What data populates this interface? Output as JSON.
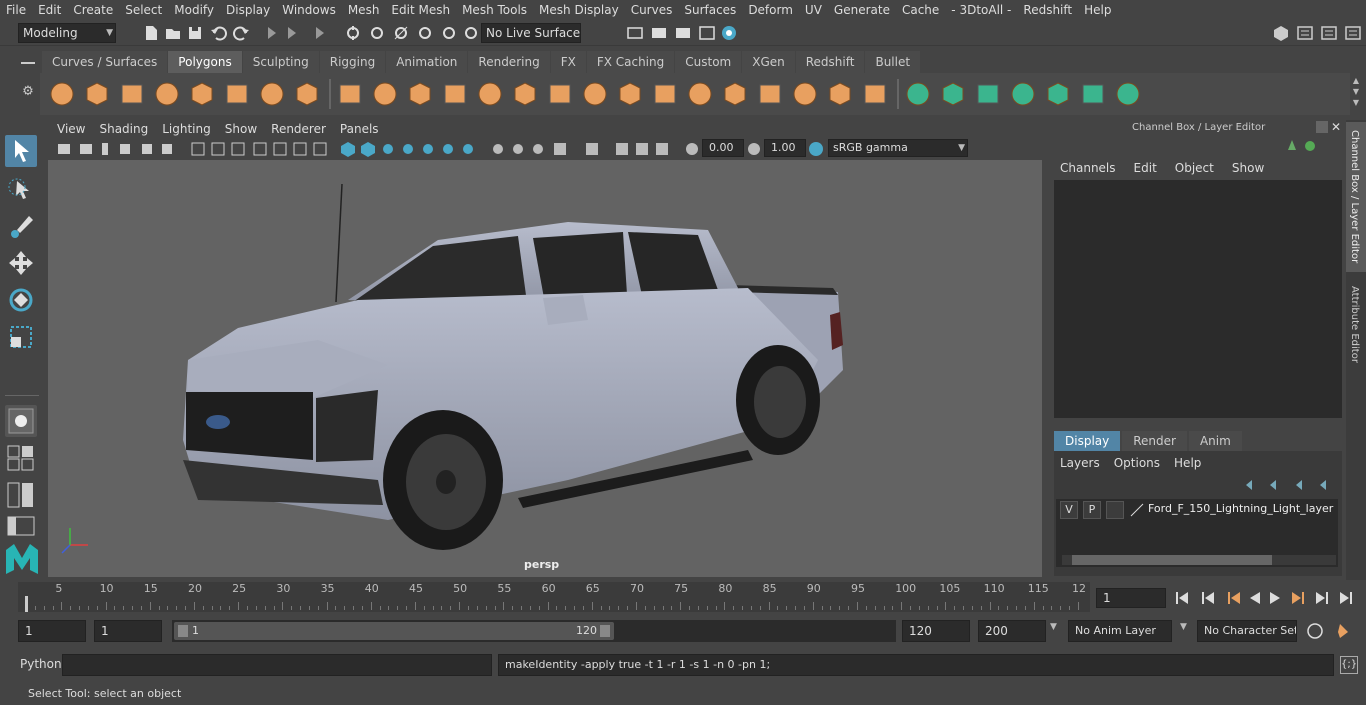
{
  "menu": [
    "File",
    "Edit",
    "Create",
    "Select",
    "Modify",
    "Display",
    "Windows",
    "Mesh",
    "Edit Mesh",
    "Mesh Tools",
    "Mesh Display",
    "Curves",
    "Surfaces",
    "Deform",
    "UV",
    "Generate",
    "Cache",
    "- 3DtoAll -",
    "Redshift",
    "Help"
  ],
  "status": {
    "mode": "Modeling",
    "live_surface": "No Live Surface"
  },
  "shelf_tabs": [
    "Curves / Surfaces",
    "Polygons",
    "Sculpting",
    "Rigging",
    "Animation",
    "Rendering",
    "FX",
    "FX Caching",
    "Custom",
    "XGen",
    "Redshift",
    "Bullet"
  ],
  "active_shelf": "Polygons",
  "viewport": {
    "menu": [
      "View",
      "Shading",
      "Lighting",
      "Show",
      "Renderer",
      "Panels"
    ],
    "exposure": "0.00",
    "gamma": "1.00",
    "colorspace": "sRGB gamma",
    "camera_label": "persp"
  },
  "channel_box": {
    "title": "Channel Box / Layer Editor",
    "menu": [
      "Channels",
      "Edit",
      "Object",
      "Show"
    ]
  },
  "layer_editor": {
    "tabs": [
      "Display",
      "Render",
      "Anim"
    ],
    "active_tab": "Display",
    "menu": [
      "Layers",
      "Options",
      "Help"
    ],
    "layers": [
      {
        "v": "V",
        "p": "P",
        "name": "Ford_F_150_Lightning_Light_layer"
      }
    ]
  },
  "side_tabs": [
    "Channel Box / Layer Editor",
    "Attribute Editor"
  ],
  "timeline": {
    "labels": [
      "5",
      "10",
      "15",
      "20",
      "25",
      "30",
      "35",
      "40",
      "45",
      "50",
      "55",
      "60",
      "65",
      "70",
      "75",
      "80",
      "85",
      "90",
      "95",
      "100",
      "105",
      "110",
      "115",
      "12"
    ],
    "start_label": "1",
    "current_frame": "1"
  },
  "range": {
    "start": "1",
    "playback_start": "1",
    "slider_start": "1",
    "slider_end": "120",
    "playback_end": "120",
    "end": "200",
    "anim_layer": "No Anim Layer",
    "character_set": "No Character Set"
  },
  "command": {
    "language": "Python",
    "input": "",
    "result": "makeIdentity -apply true -t 1 -r 1 -s 1 -n 0 -pn 1;"
  },
  "help_line": "Select Tool: select an object",
  "colors": {
    "accent": "#5285a6",
    "shelf_orange": "#e8a060",
    "shelf_green": "#3bb58e"
  }
}
